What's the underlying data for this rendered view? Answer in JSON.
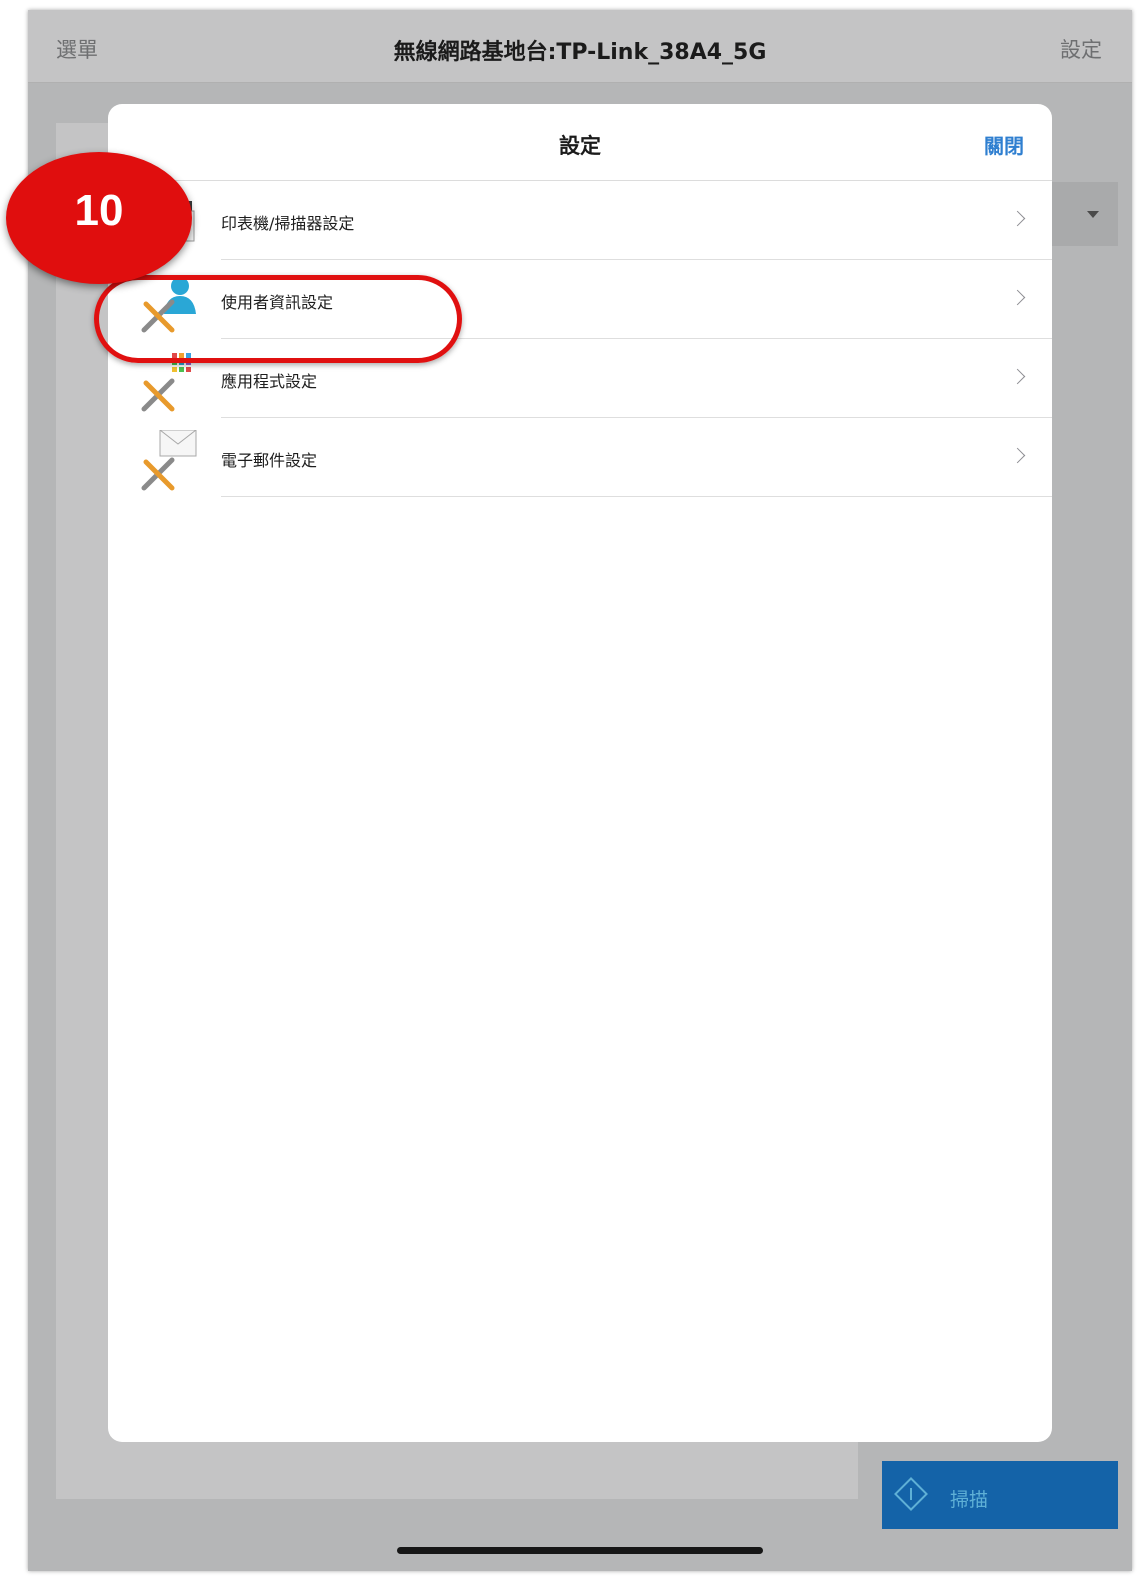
{
  "navbar": {
    "menu_label": "選單",
    "title": "無線網路基地台:TP-Link_38A4_5G",
    "settings_label": "設定"
  },
  "modal": {
    "title": "設定",
    "close_label": "關閉",
    "items": [
      {
        "label": "印表機/掃描器設定",
        "icon": "printer-scanner-settings-icon"
      },
      {
        "label": "使用者資訊設定",
        "icon": "user-info-settings-icon"
      },
      {
        "label": "應用程式設定",
        "icon": "app-settings-icon"
      },
      {
        "label": "電子郵件設定",
        "icon": "email-settings-icon"
      }
    ]
  },
  "scan_button": {
    "label": "掃描",
    "icon": "scan-start-icon"
  },
  "annotation": {
    "step_number": "10",
    "highlight_color": "#e01010"
  },
  "colors": {
    "accent": "#2f7fd0",
    "scan_button": "#1463a8",
    "badge": "#e00e0e"
  }
}
